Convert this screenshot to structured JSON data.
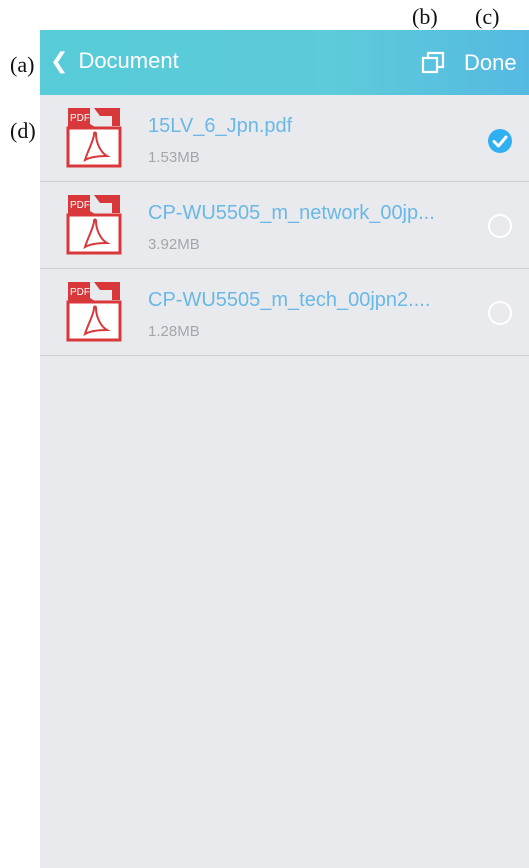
{
  "callouts": {
    "a": "(a)",
    "b": "(b)",
    "c": "(c)",
    "d": "(d)"
  },
  "header": {
    "back_chevron": "❮",
    "title": "Document",
    "copy_icon": "copy-icon",
    "done_label": "Done",
    "colors": {
      "gradient_start": "#57cbd8",
      "gradient_end": "#56b9e2"
    }
  },
  "files": [
    {
      "name": "15LV_6_Jpn.pdf",
      "size": "1.53MB",
      "selected": true,
      "icon_label": "PDF"
    },
    {
      "name": "CP-WU5505_m_network_00jp...",
      "size": "3.92MB",
      "selected": false,
      "icon_label": "PDF"
    },
    {
      "name": "CP-WU5505_m_tech_00jpn2....",
      "size": "1.28MB",
      "selected": false,
      "icon_label": "PDF"
    }
  ],
  "colors": {
    "file_name": "#69b8e6",
    "check_selected": "#2fb0f0",
    "pdf_red": "#d9383a"
  }
}
